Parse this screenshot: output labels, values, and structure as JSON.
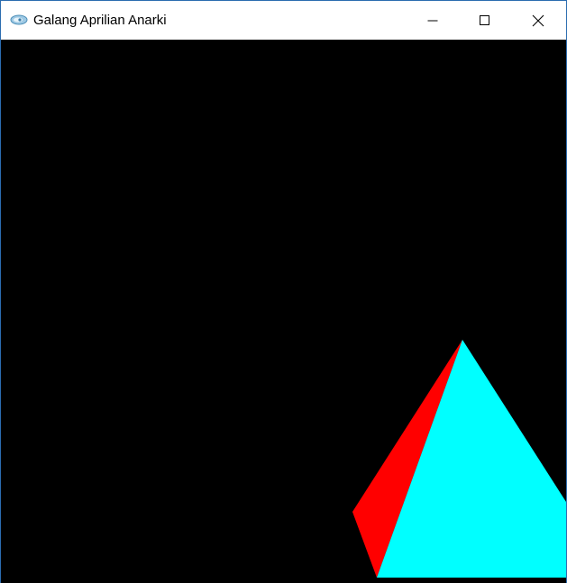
{
  "window": {
    "title": "Galang Aprilian Anarki",
    "icon": "app-icon",
    "controls": [
      {
        "name": "minimize-icon"
      },
      {
        "name": "maximize-icon"
      },
      {
        "name": "close-icon"
      }
    ]
  },
  "scene": {
    "background_color": "#000000",
    "objects": [
      {
        "name": "pyramid-left-face",
        "color": "#ff0000"
      },
      {
        "name": "pyramid-front-face",
        "color": "#00ffff"
      }
    ]
  }
}
